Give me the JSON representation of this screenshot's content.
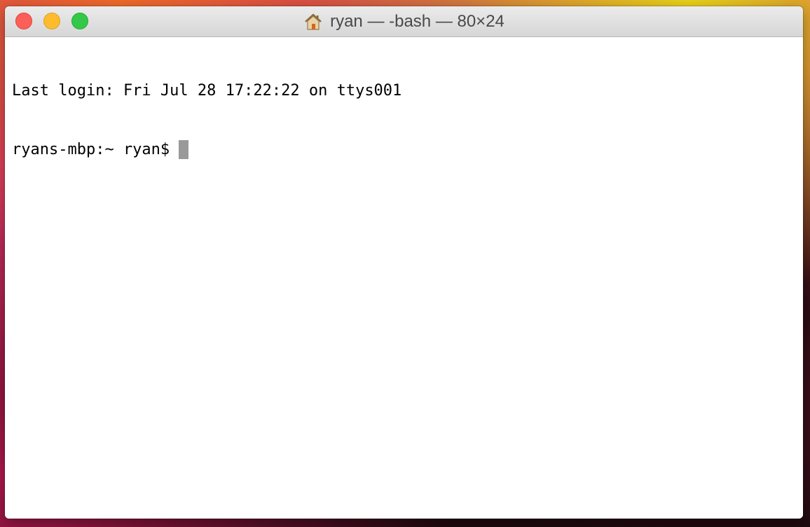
{
  "window": {
    "title": "ryan — -bash — 80×24",
    "title_icon": "home-icon",
    "traffic_lights": {
      "close_color": "#fc5f57",
      "minimize_color": "#fdbc2e",
      "zoom_color": "#34c849"
    }
  },
  "terminal": {
    "lines": [
      "Last login: Fri Jul 28 17:22:22 on ttys001"
    ],
    "prompt": "ryans-mbp:~ ryan$",
    "cursor_color": "#999999"
  }
}
